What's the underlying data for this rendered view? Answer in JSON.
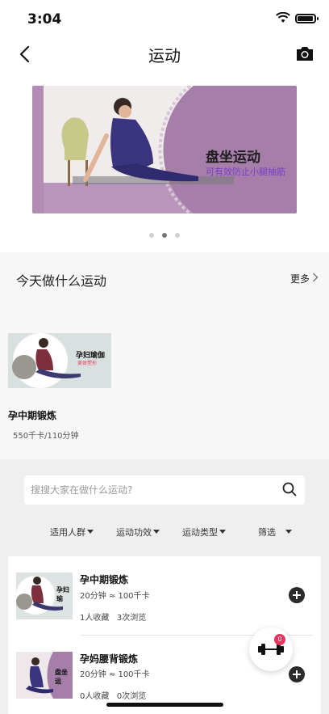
{
  "status_bar": {
    "time": "3:04"
  },
  "nav": {
    "title": "运动"
  },
  "banner": {
    "title": "盘坐运动",
    "subtitle": "可有效防止小腿抽筋",
    "dots": 3,
    "active_dot": 1,
    "colors": {
      "accent_purple": "#a57ea9",
      "subtitle": "#7a3cc8"
    }
  },
  "today": {
    "heading": "今天做什么运动",
    "more_label": "更多",
    "card": {
      "image_text": "孕妇瑜伽",
      "image_subtext": "美体塑形",
      "title": "孕中期锻炼",
      "meta": "550千卡/110分钟"
    }
  },
  "search": {
    "placeholder": "搜搜大家在做什么运动?"
  },
  "filters": [
    "适用人群",
    "运动功效",
    "运动类型",
    "筛选"
  ],
  "list": [
    {
      "name": "孕中期锻炼",
      "meta": "20分钟 ≈ 100千卡",
      "favorites": "1人收藏",
      "views": "3次浏览",
      "thumb_text": "孕妇瑜"
    },
    {
      "name": "孕妈腰背锻炼",
      "meta": "20分钟 ≈ 100千卡",
      "favorites": "0人收藏",
      "views": "0次浏览",
      "thumb_text": "盘坐运"
    }
  ],
  "fab": {
    "badge": "0",
    "icon": "dumbbell-icon",
    "badge_color": "#e8355d"
  }
}
